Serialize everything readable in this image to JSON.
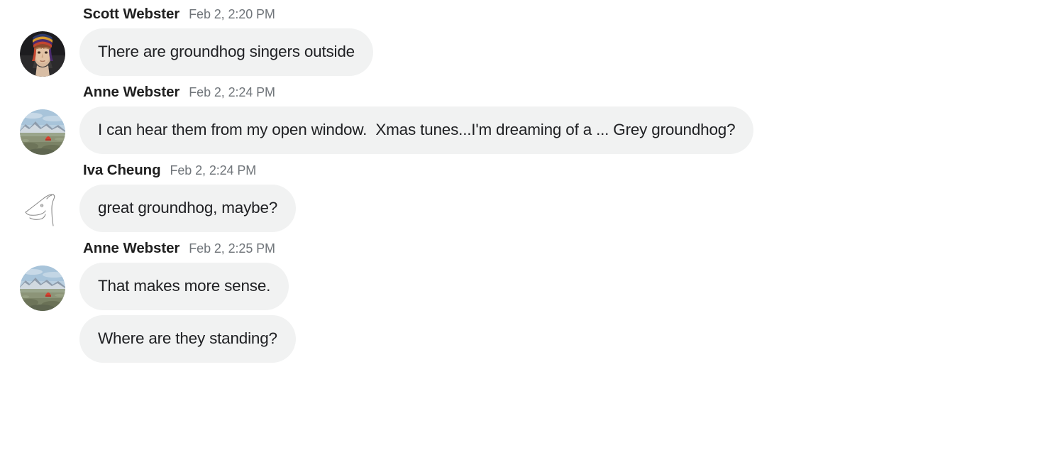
{
  "thread": {
    "background_color": "#ffffff",
    "bubble_color": "#f1f2f2",
    "text_color": "#202124",
    "name_color": "#1f1f1f",
    "timestamp_color": "#70757a",
    "groups": [
      {
        "sender": "Scott Webster",
        "timestamp": "Feb 2, 2:20 PM",
        "avatar": "photo-person-striped-knit-hat",
        "messages": [
          "There are groundhog singers outside"
        ]
      },
      {
        "sender": "Anne Webster",
        "timestamp": "Feb 2, 2:24 PM",
        "avatar": "photo-mountain-landscape-red-tent",
        "messages": [
          "I can hear them from my open window.  Xmas tunes...I'm dreaming of a ... Grey groundhog?"
        ]
      },
      {
        "sender": "Iva Cheung",
        "timestamp": "Feb 2, 2:24 PM",
        "avatar": "line-drawing-animal-head",
        "messages": [
          "great groundhog, maybe?"
        ]
      },
      {
        "sender": "Anne Webster",
        "timestamp": "Feb 2, 2:25 PM",
        "avatar": "photo-mountain-landscape-red-tent",
        "messages": [
          "That makes more sense.",
          "Where are they standing?"
        ]
      }
    ]
  }
}
